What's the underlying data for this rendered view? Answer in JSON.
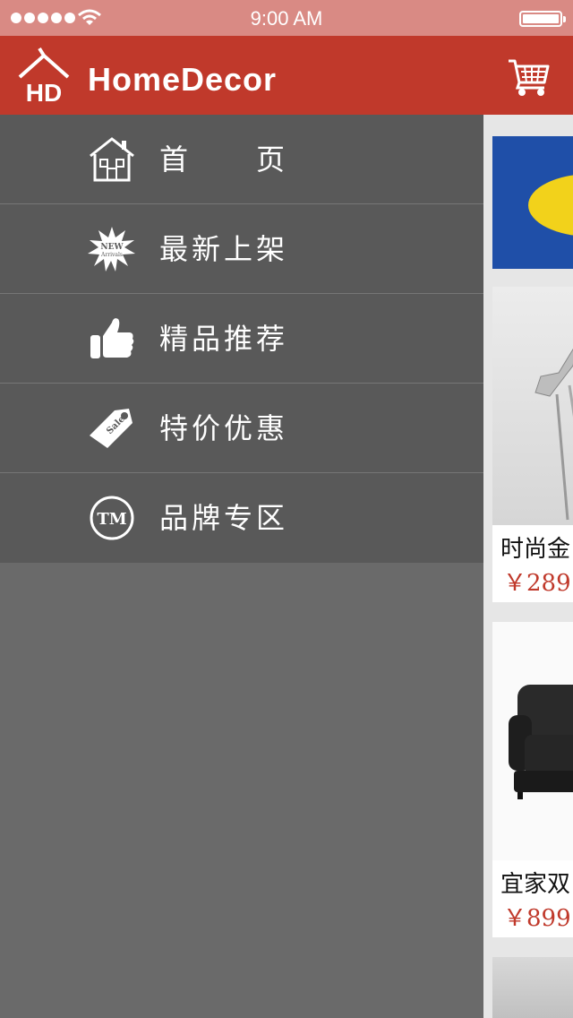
{
  "status_bar": {
    "time": "9:00 AM"
  },
  "header": {
    "brand": "HomeDecor",
    "logo_text": "HD"
  },
  "menu": {
    "items": [
      {
        "label": "首　　页",
        "icon": "home-icon"
      },
      {
        "label": "最新上架",
        "icon": "new-arrivals-badge-icon",
        "badge_top": "NEW",
        "badge_bottom": "Arrivals"
      },
      {
        "label": "精品推荐",
        "icon": "thumbs-up-icon"
      },
      {
        "label": "特价优惠",
        "icon": "sale-tag-icon",
        "tag_text": "Sales"
      },
      {
        "label": "品牌专区",
        "icon": "trademark-icon",
        "tm_text": "TM"
      }
    ]
  },
  "content": {
    "products": [
      {
        "name": "时尚金",
        "price": "￥289"
      },
      {
        "name": "宜家双",
        "price": "￥899"
      }
    ]
  },
  "colors": {
    "header": "#c0392b",
    "status_bar": "#d98a84",
    "menu_bg": "#595959",
    "drawer_bg": "#6a6a6a",
    "price": "#c0392b"
  }
}
